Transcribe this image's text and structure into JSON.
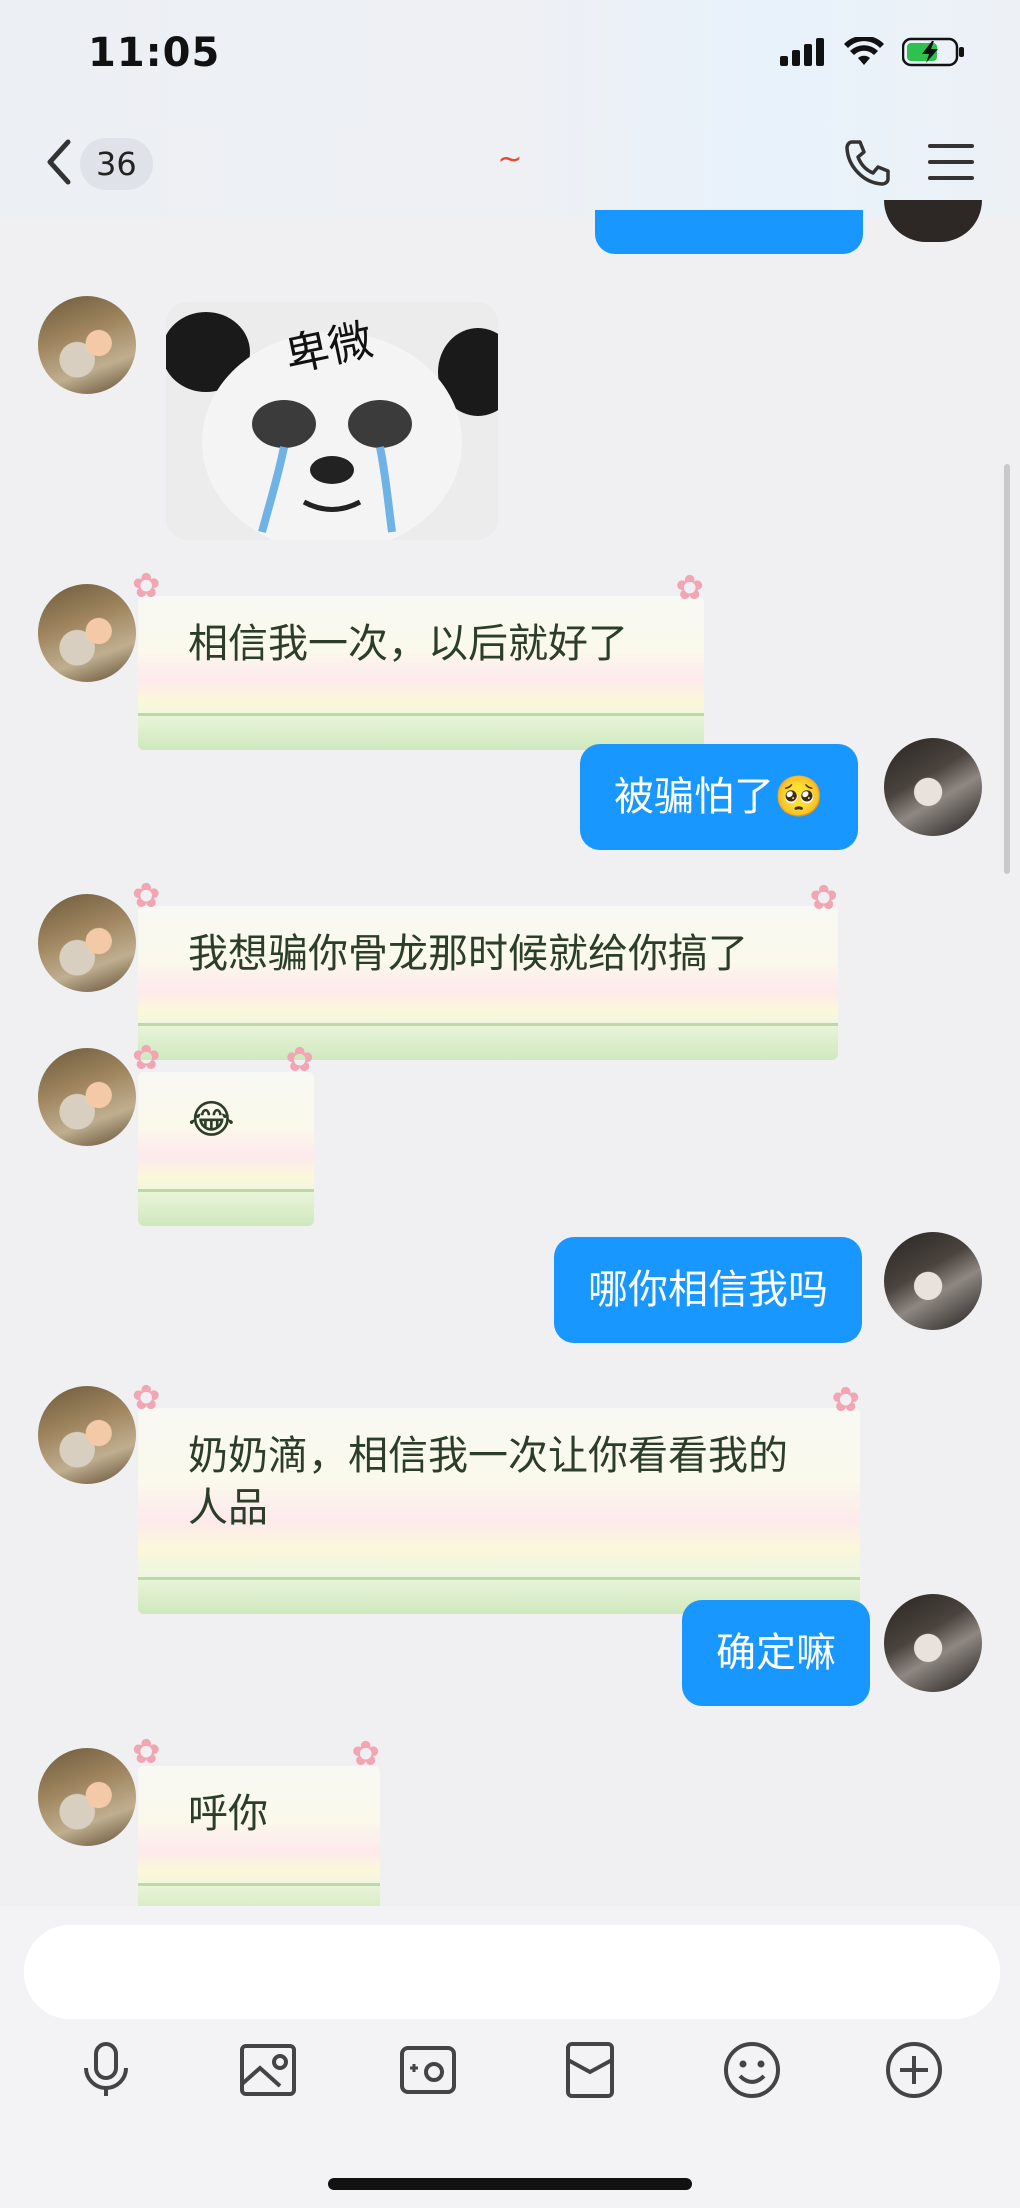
{
  "status_bar": {
    "time": "11:05"
  },
  "header": {
    "unread_count": "36",
    "title": "~"
  },
  "messages": [
    {
      "from": "friend",
      "type": "sticker",
      "sticker_text": "卑微"
    },
    {
      "from": "friend",
      "type": "text",
      "text": "相信我一次，以后就好了"
    },
    {
      "from": "me",
      "type": "text",
      "text": "被骗怕了🥺"
    },
    {
      "from": "friend",
      "type": "text",
      "text": "我想骗你骨龙那时候就给你搞了"
    },
    {
      "from": "friend",
      "type": "text",
      "text": "😂"
    },
    {
      "from": "me",
      "type": "text",
      "text": "哪你相信我吗"
    },
    {
      "from": "friend",
      "type": "text",
      "text_line1": "奶奶滴，相信我一次让你看看我的",
      "text_line2": "人品"
    },
    {
      "from": "me",
      "type": "text",
      "text": "确定嘛"
    },
    {
      "from": "friend",
      "type": "text",
      "text": "呼你"
    }
  ],
  "input": {
    "placeholder": ""
  },
  "toolbar": {
    "icons": [
      "microphone-icon",
      "image-icon",
      "camera-icon",
      "red-packet-icon",
      "emoji-icon",
      "plus-icon"
    ]
  },
  "colors": {
    "me_bubble": "#1797ff",
    "background": "#f0f0f2"
  }
}
